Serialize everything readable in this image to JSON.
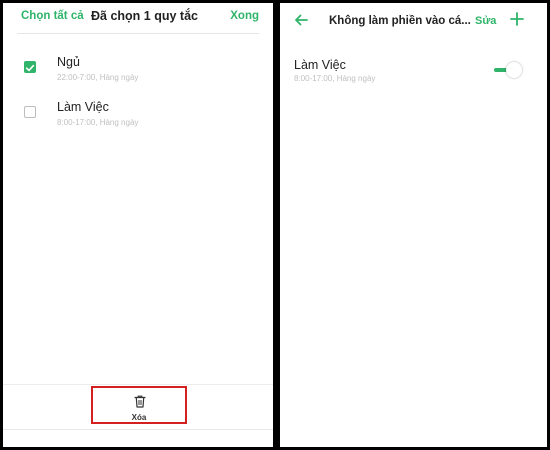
{
  "left": {
    "header": {
      "select_all": "Chọn tất cả",
      "title": "Đã chọn 1 quy tắc",
      "done": "Xong"
    },
    "rules": [
      {
        "name": "Ngủ",
        "schedule": "22:00-7:00, Hàng ngày",
        "checked": true
      },
      {
        "name": "Làm Việc",
        "schedule": "8:00-17:00, Hàng ngày",
        "checked": false
      }
    ],
    "bottom": {
      "delete_label": "Xóa",
      "icon": "trash-icon"
    }
  },
  "right": {
    "header": {
      "back_icon": "back-arrow-icon",
      "title": "Không làm phiền vào cá...",
      "edit": "Sửa",
      "add_icon": "plus-icon"
    },
    "rule": {
      "name": "Làm Việc",
      "schedule": "8:00-17:00, Hàng ngày",
      "enabled": true
    }
  },
  "colors": {
    "accent": "#2fb469",
    "highlight": "#d32020"
  }
}
